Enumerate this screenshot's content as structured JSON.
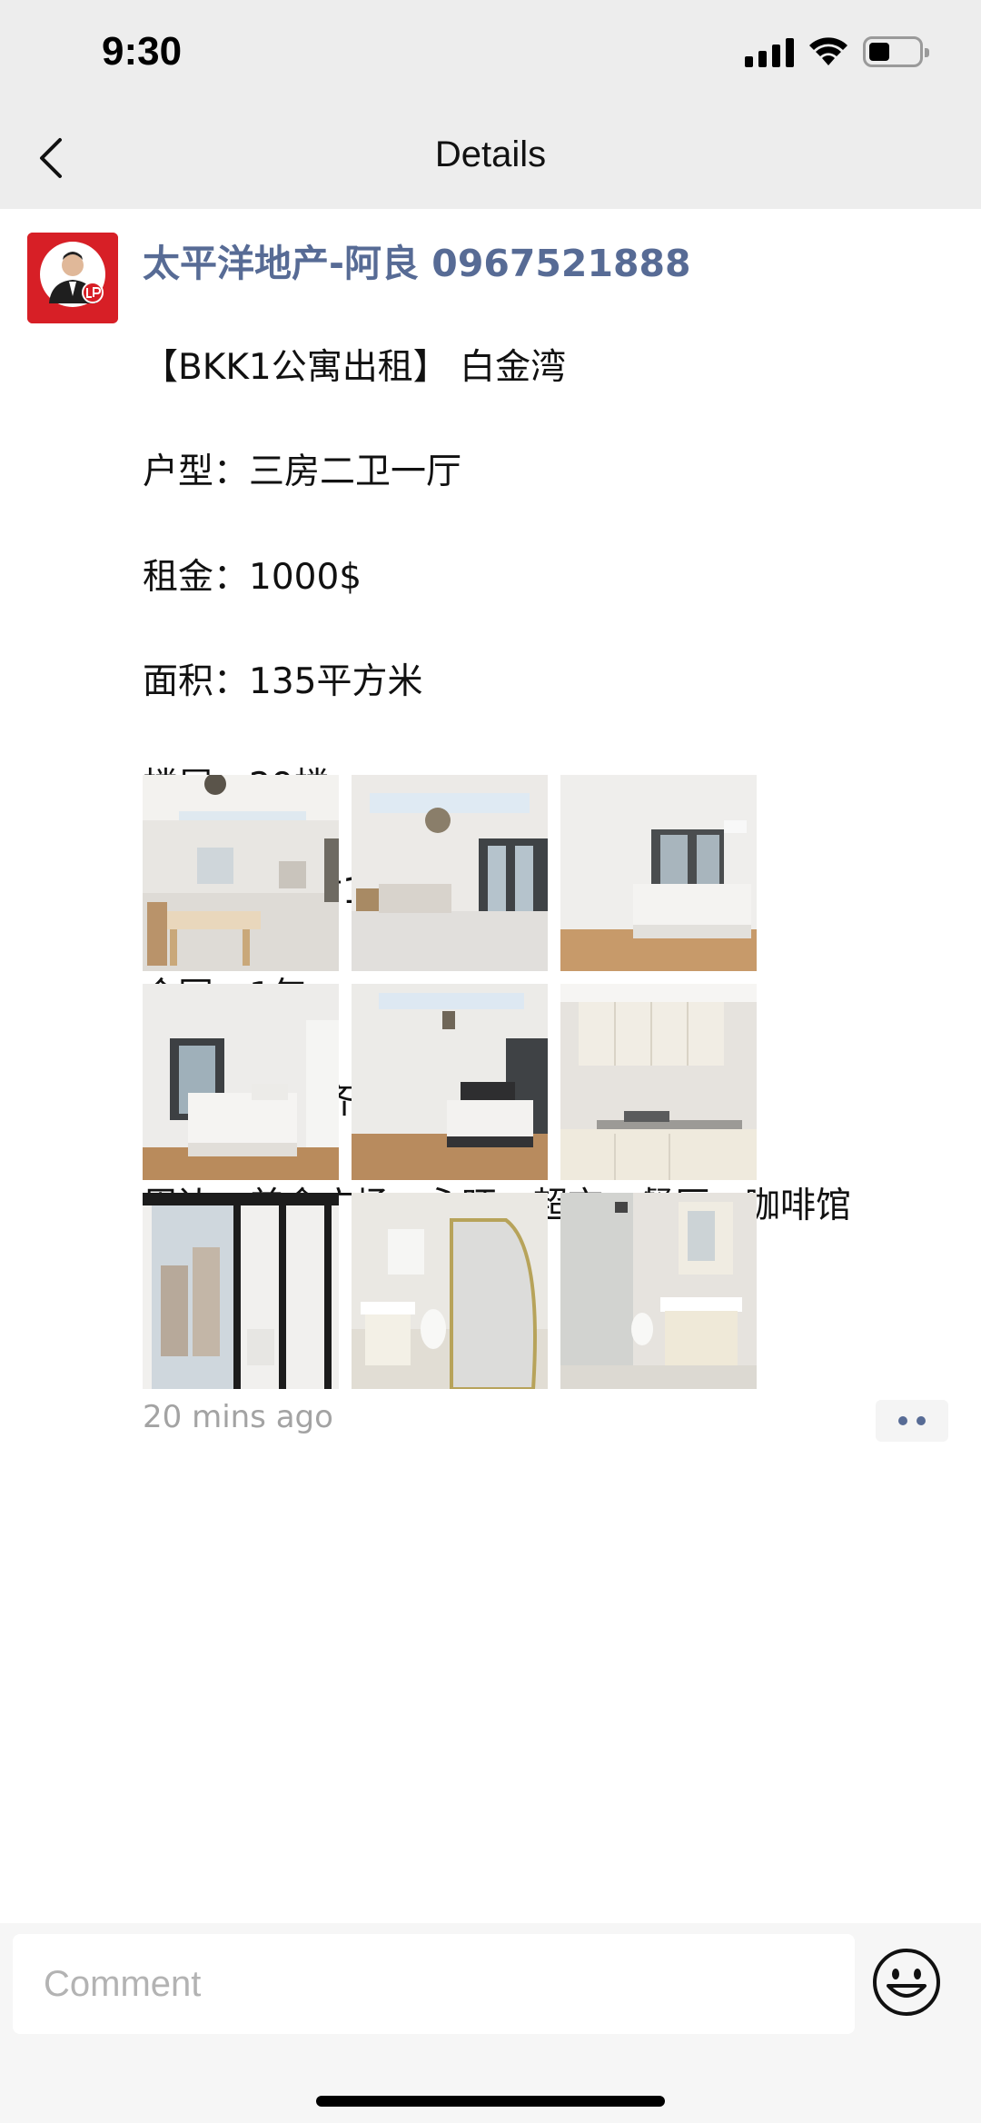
{
  "status_bar": {
    "time": "9:30"
  },
  "nav": {
    "title": "Details"
  },
  "post": {
    "author": "太平洋地产-阿良 0967521888",
    "lines": [
      "【BKK1公寓出租】 白金湾",
      "户型：三房二卫一厅",
      "租金：1000$",
      "面积：135平方米",
      "楼层：29楼",
      "押金：押1付1",
      "合同：1年",
      "配套：家具齐全",
      "周边：美食广场，永旺一超市，餐厅，咖啡馆"
    ],
    "photos": [
      "living-room",
      "living-room",
      "bedroom",
      "bedroom",
      "bedroom",
      "kitchen",
      "balcony",
      "bathroom",
      "bathroom"
    ],
    "time_ago": "20 mins ago"
  },
  "comment": {
    "placeholder": "Comment"
  },
  "colors": {
    "author": "#576b95",
    "avatar_bg": "#d71f26",
    "nav_bg": "#ededed"
  }
}
